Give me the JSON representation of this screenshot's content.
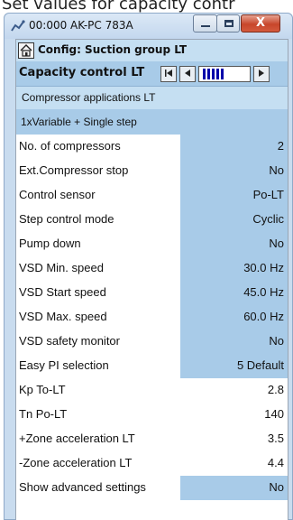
{
  "caption": "Set values for capacity contr",
  "window": {
    "title": "00:000 AK-PC 783A",
    "close_label": "X",
    "icon": "network-app-icon"
  },
  "header": {
    "config_title": "Config: Suction group LT",
    "capacity_title": "Capacity control LT",
    "nav_icons": [
      "first-page-icon",
      "previous-page-icon",
      "page-progress-bar",
      "next-page-icon"
    ],
    "progress_fraction": 0.45
  },
  "section": {
    "title": "Compressor applications LT",
    "selected_value": "1xVariable + Single step"
  },
  "params": [
    {
      "label": "No. of compressors",
      "value": "2",
      "editable": true
    },
    {
      "label": "Ext.Compressor stop",
      "value": "No",
      "editable": true
    },
    {
      "label": "Control sensor",
      "value": "Po-LT",
      "editable": true
    },
    {
      "label": "Step control mode",
      "value": "Cyclic",
      "editable": true
    },
    {
      "label": "Pump down",
      "value": "No",
      "editable": true
    },
    {
      "label": "VSD Min. speed",
      "value": "30.0 Hz",
      "editable": true
    },
    {
      "label": "VSD Start speed",
      "value": "45.0 Hz",
      "editable": true
    },
    {
      "label": "VSD Max. speed",
      "value": "60.0 Hz",
      "editable": true
    },
    {
      "label": "VSD safety monitor",
      "value": "No",
      "editable": true
    },
    {
      "label": "Easy PI selection",
      "value": "5 Default",
      "editable": true
    },
    {
      "label": "Kp To-LT",
      "value": "2.8",
      "editable": false
    },
    {
      "label": "Tn Po-LT",
      "value": "140",
      "editable": false
    },
    {
      "label": "+Zone acceleration LT",
      "value": "3.5",
      "editable": false
    },
    {
      "label": "-Zone acceleration LT",
      "value": "4.4",
      "editable": false
    },
    {
      "label": "Show advanced settings",
      "value": "No",
      "editable": true
    }
  ],
  "colors": {
    "header_light": "#c5dff2",
    "header_mid": "#a8cbe8",
    "window_frame": "#c9dcef",
    "close_red": "#c7462b"
  }
}
